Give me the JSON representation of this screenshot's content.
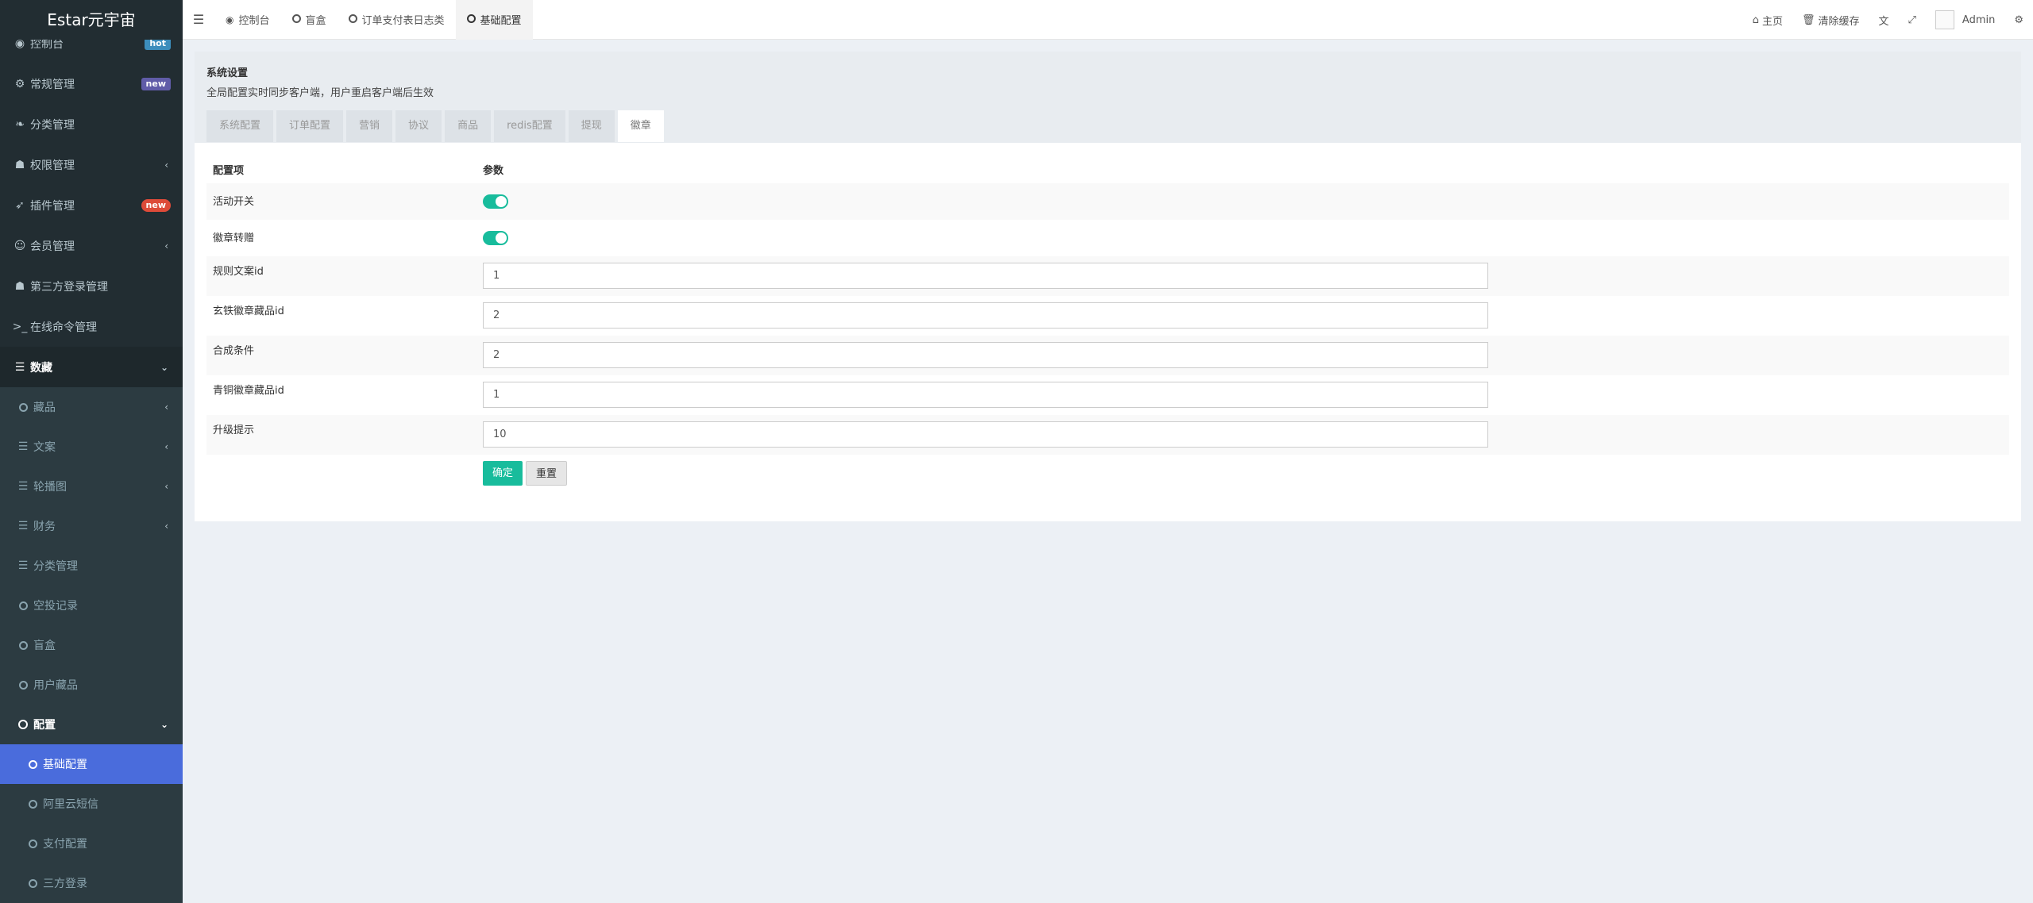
{
  "app": {
    "logo": "Estar元宇宙"
  },
  "sidebar": {
    "items": [
      {
        "label": "控制台",
        "badge": "hot"
      },
      {
        "label": "常规管理",
        "badge": "new"
      },
      {
        "label": "分类管理"
      },
      {
        "label": "权限管理",
        "arrow": "‹"
      },
      {
        "label": "插件管理",
        "badge": "new"
      },
      {
        "label": "会员管理",
        "arrow": "‹"
      },
      {
        "label": "第三方登录管理"
      },
      {
        "label": "在线命令管理"
      },
      {
        "label": "数藏",
        "arrow": "⌄"
      },
      {
        "label": "藏品",
        "arrow": "‹"
      },
      {
        "label": "文案",
        "arrow": "‹"
      },
      {
        "label": "轮播图",
        "arrow": "‹"
      },
      {
        "label": "财务",
        "arrow": "‹"
      },
      {
        "label": "分类管理"
      },
      {
        "label": "空投记录"
      },
      {
        "label": "盲盒"
      },
      {
        "label": "用户藏品"
      },
      {
        "label": "配置",
        "arrow": "⌄"
      },
      {
        "label": "基础配置"
      },
      {
        "label": "阿里云短信"
      },
      {
        "label": "支付配置"
      },
      {
        "label": "三方登录"
      }
    ]
  },
  "header": {
    "tabs": [
      {
        "label": "控制台"
      },
      {
        "label": "盲盒"
      },
      {
        "label": "订单支付表日志类"
      },
      {
        "label": "基础配置"
      }
    ],
    "right": {
      "home": "主页",
      "clear_cache": "清除缓存",
      "user": "Admin"
    }
  },
  "panel": {
    "title": "系统设置",
    "subtitle": "全局配置实时同步客户端，用户重启客户端后生效",
    "tabs": [
      "系统配置",
      "订单配置",
      "营销",
      "协议",
      "商品",
      "redis配置",
      "提现",
      "徽章"
    ],
    "active_tab": "徽章",
    "columns": {
      "key": "配置项",
      "value": "参数"
    },
    "rows": [
      {
        "label": "活动开关",
        "type": "toggle",
        "on": true
      },
      {
        "label": "徽章转赠",
        "type": "toggle",
        "on": true
      },
      {
        "label": "规则文案id",
        "type": "input",
        "value": "1"
      },
      {
        "label": "玄铁徽章藏品id",
        "type": "input",
        "value": "2"
      },
      {
        "label": "合成条件",
        "type": "input",
        "value": "2"
      },
      {
        "label": "青铜徽章藏品id",
        "type": "input",
        "value": "1"
      },
      {
        "label": "升级提示",
        "type": "input",
        "value": "10"
      }
    ],
    "buttons": {
      "confirm": "确定",
      "reset": "重置"
    }
  },
  "colors": {
    "accent": "#18bc9c",
    "sidebar_bg": "#222d32",
    "selected": "#4a6cdc"
  }
}
